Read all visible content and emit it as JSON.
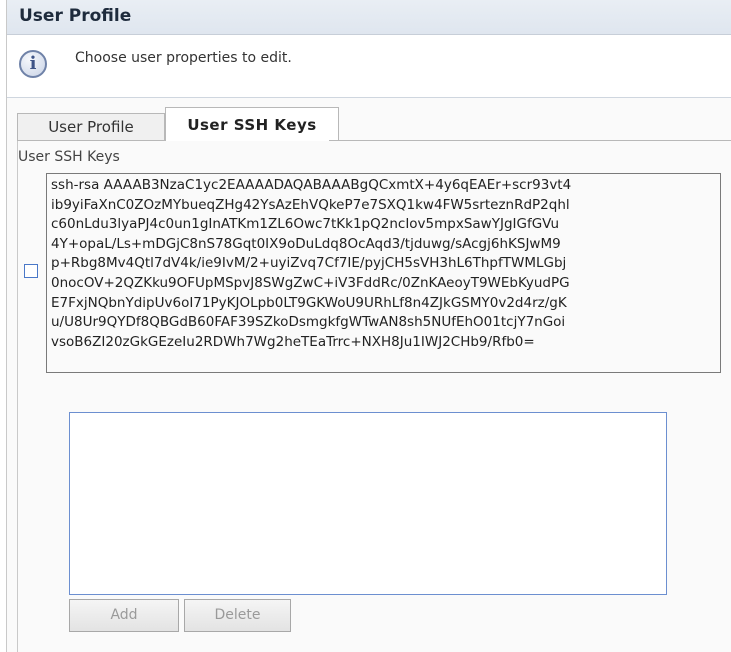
{
  "header": {
    "title": "User Profile"
  },
  "info": {
    "message": "Choose user properties to edit.",
    "icon": "info-icon"
  },
  "tabs": [
    {
      "label": "User Profile",
      "active": false
    },
    {
      "label": "User SSH Keys",
      "active": true
    }
  ],
  "ssh_section": {
    "label": "User SSH Keys",
    "keys": [
      {
        "checked": false,
        "lines": [
          "ssh-rsa AAAAB3NzaC1yc2EAAAADAQABAAABgQCxmtX+4y6qEAEr+scr93vt4",
          "ib9yiFaXnC0ZOzMYbueqZHg42YsAzEhVQkeP7e7SXQ1kw4FW5srteznRdP2qhl",
          "c60nLdu3lyaPJ4c0un1gInATKm1ZL6Owc7tKk1pQ2ncIov5mpxSawYJgIGfGVu",
          "4Y+opaL/Ls+mDGjC8nS78Gqt0IX9oDuLdq8OcAqd3/tjduwg/sAcgj6hKSJwM9",
          "p+Rbg8Mv4Qtl7dV4k/ie9IvM/2+uyiZvq7Cf7IE/pyjCH5sVH3hL6ThpfTWMLGbj",
          "0nocOV+2QZKku9OFUpMSpvJ8SWgZwC+iV3FddRc/0ZnKAeoyT9WEbKyudPG",
          "E7FxjNQbnYdipUv6oI71PyKJOLpb0LT9GKWoU9URhLf8n4ZJkGSMY0v2d4rz/gK",
          "u/U8Ur9QYDf8QBGdB60FAF39SZkoDsmgkfgWTwAN8sh5NUfEhO01tcjY7nGoi",
          "vsoB6ZI20zGkGEzeIu2RDWh7Wg2heTEaTrrc+NXH8Ju1IWJ2CHb9/Rfb0="
        ]
      }
    ],
    "new_key_value": "",
    "add_label": "Add",
    "delete_label": "Delete"
  }
}
